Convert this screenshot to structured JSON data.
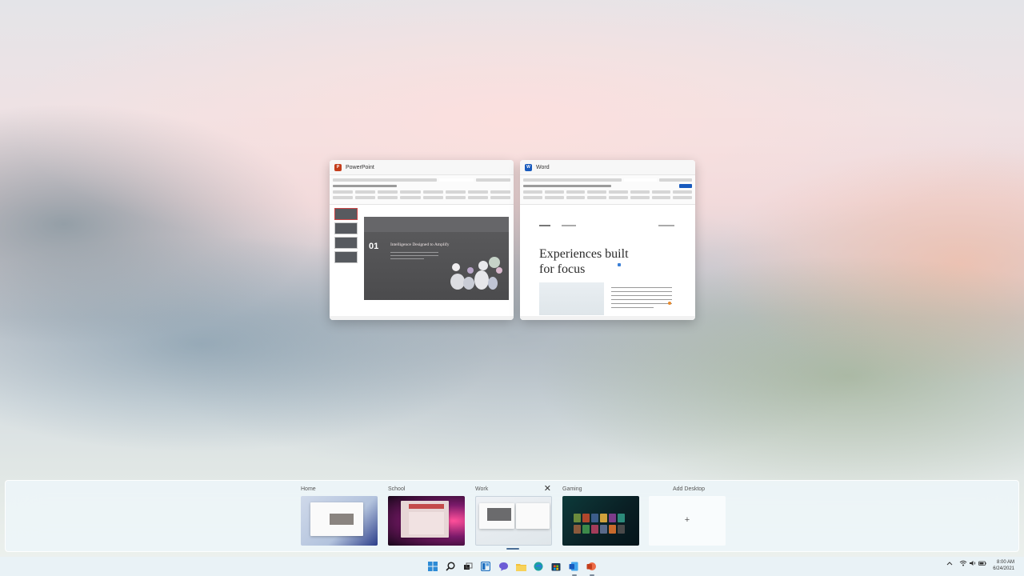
{
  "windows": [
    {
      "id": "powerpoint",
      "title": "PowerPoint",
      "accent": "#c43e1c"
    },
    {
      "id": "word",
      "title": "Word",
      "accent": "#185abd"
    }
  ],
  "powerpoint": {
    "slide_number": "01",
    "slide_title": "Intelligence Designed to Amplify"
  },
  "word": {
    "heading": "Experiences built for focus"
  },
  "desktops": [
    {
      "label": "Home",
      "active": false
    },
    {
      "label": "School",
      "active": false
    },
    {
      "label": "Work",
      "active": true
    },
    {
      "label": "Gaming",
      "active": false
    }
  ],
  "add_desktop": {
    "label": "Add Desktop",
    "symbol": "+"
  },
  "close_symbol": "✕",
  "taskbar": {
    "icons": [
      "start-icon",
      "search-icon",
      "task-view-icon",
      "widgets-icon",
      "chat-icon",
      "file-explorer-icon",
      "edge-icon",
      "store-icon",
      "word-icon",
      "powerpoint-icon"
    ]
  },
  "tray": {
    "time": "8:00 AM",
    "date": "6/24/2021",
    "icons": [
      "chevron-up-icon",
      "wifi-icon",
      "volume-icon",
      "battery-icon"
    ]
  }
}
